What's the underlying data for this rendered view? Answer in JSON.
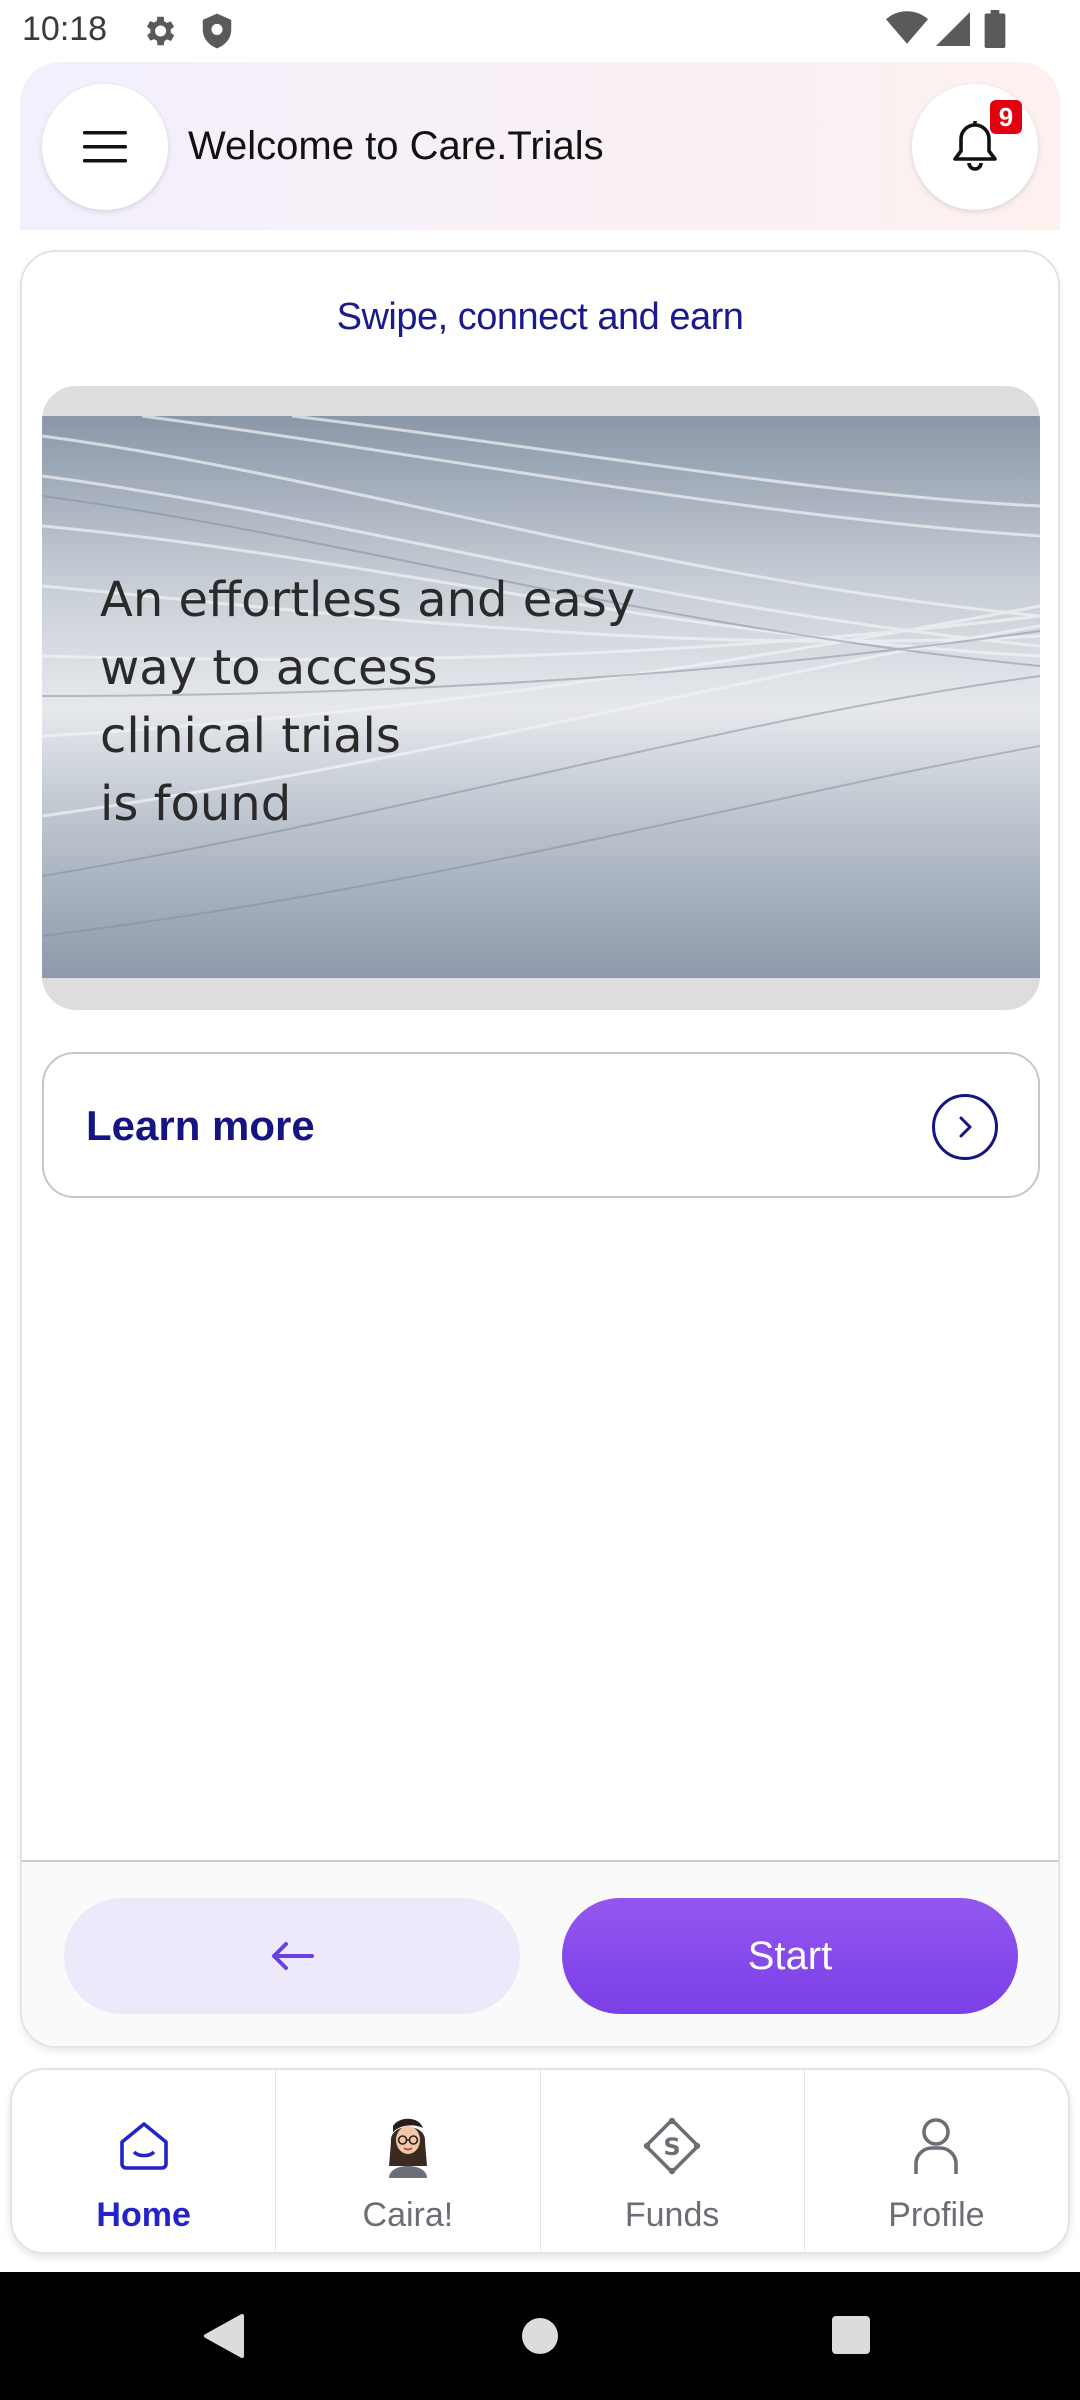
{
  "status_bar": {
    "time": "10:18",
    "left_icons": [
      "gear-icon",
      "shield-icon"
    ],
    "right_icons": [
      "wifi-icon",
      "signal-icon",
      "battery-icon"
    ]
  },
  "header": {
    "title": "Welcome to Care.Trials",
    "notification_count": "9"
  },
  "card": {
    "heading": "Swipe, connect and earn",
    "hero_lines": [
      "An effortless and easy",
      "way to access",
      "clinical trials",
      "is found"
    ],
    "learn_more_label": "Learn more",
    "start_label": "Start"
  },
  "bottom_nav": {
    "items": [
      {
        "label": "Home",
        "icon": "home-icon",
        "active": true
      },
      {
        "label": "Caira!",
        "icon": "avatar",
        "active": false
      },
      {
        "label": "Funds",
        "icon": "funds-icon",
        "active": false
      },
      {
        "label": "Profile",
        "icon": "profile-icon",
        "active": false
      }
    ]
  },
  "colors": {
    "accent_purple": "#7a3fe6",
    "navy_text": "#141483",
    "active_nav": "#2323c8",
    "badge_red": "#e3000f"
  }
}
